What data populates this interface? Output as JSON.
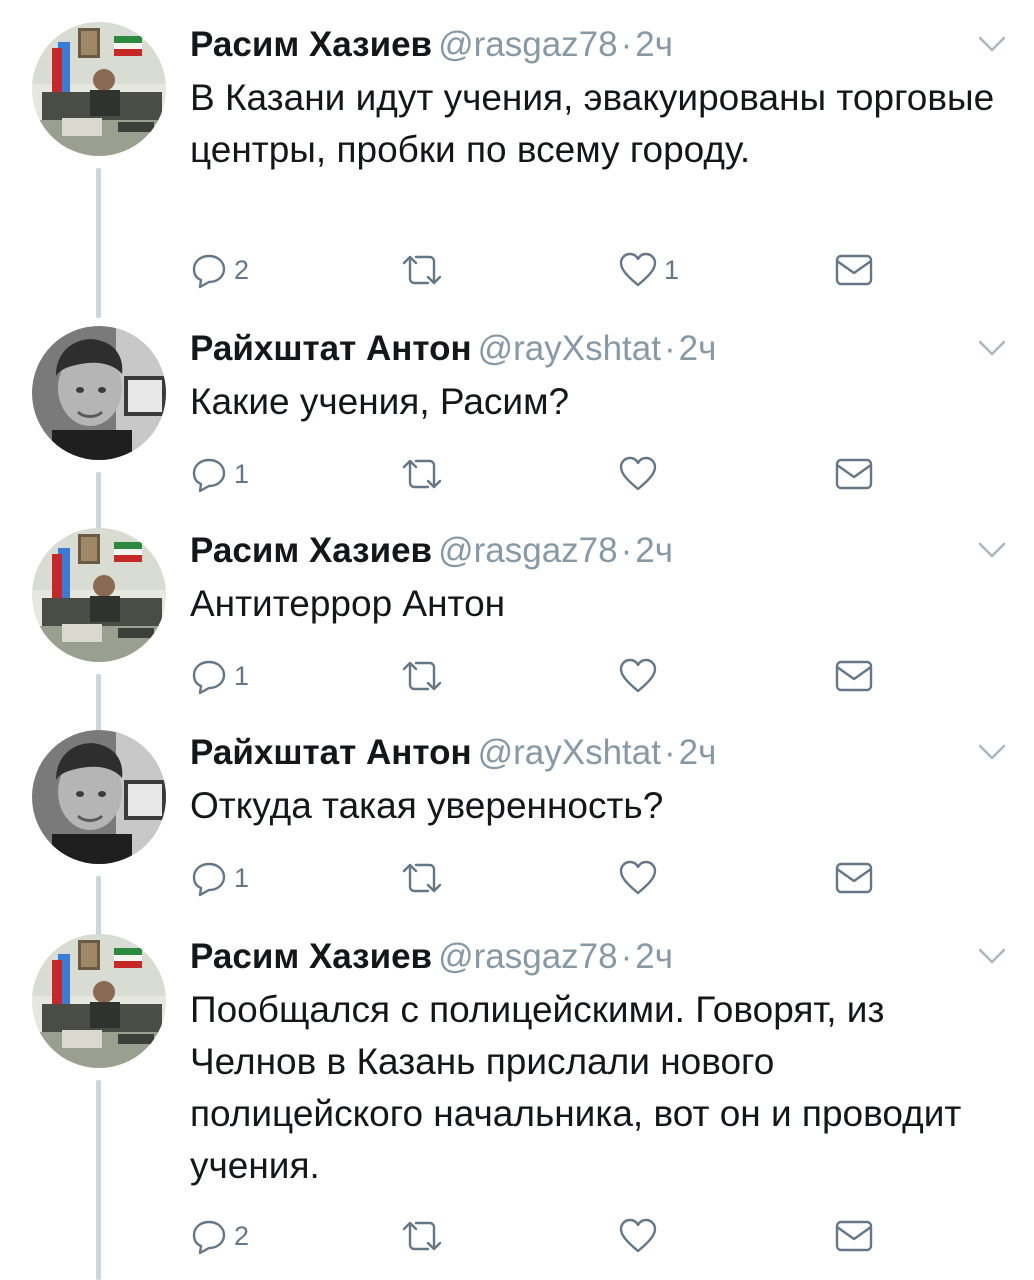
{
  "colors": {
    "muted": "#8899a6",
    "text": "#14171a",
    "thread_line": "#ccd6dd"
  },
  "tweets": [
    {
      "name": "Расим Хазиев",
      "handle": "@rasgaz78",
      "separator": "·",
      "time": "2ч",
      "text": "В Казани идут учения, эвакуированы торговые центры, пробки по всему городу.",
      "reply_count": "2",
      "retweet_count": "",
      "like_count": "1",
      "avatar": "office-photo"
    },
    {
      "name": "Райхштат Антон",
      "handle": "@rayXshtat",
      "separator": "·",
      "time": "2ч",
      "text": "Какие учения, Расим?",
      "reply_count": "1",
      "retweet_count": "",
      "like_count": "",
      "avatar": "portrait-photo"
    },
    {
      "name": "Расим Хазиев",
      "handle": "@rasgaz78",
      "separator": "·",
      "time": "2ч",
      "text": "Антитеррор Антон",
      "reply_count": "1",
      "retweet_count": "",
      "like_count": "",
      "avatar": "office-photo"
    },
    {
      "name": "Райхштат Антон",
      "handle": "@rayXshtat",
      "separator": "·",
      "time": "2ч",
      "text": "Откуда такая уверенность?",
      "reply_count": "1",
      "retweet_count": "",
      "like_count": "",
      "avatar": "portrait-photo"
    },
    {
      "name": "Расим Хазиев",
      "handle": "@rasgaz78",
      "separator": "·",
      "time": "2ч",
      "text": "Пообщался с полицейскими. Говорят, из Челнов в Казань прислали нового полицейского начальника, вот он и проводит учения.",
      "reply_count": "2",
      "retweet_count": "",
      "like_count": "",
      "avatar": "office-photo"
    }
  ]
}
